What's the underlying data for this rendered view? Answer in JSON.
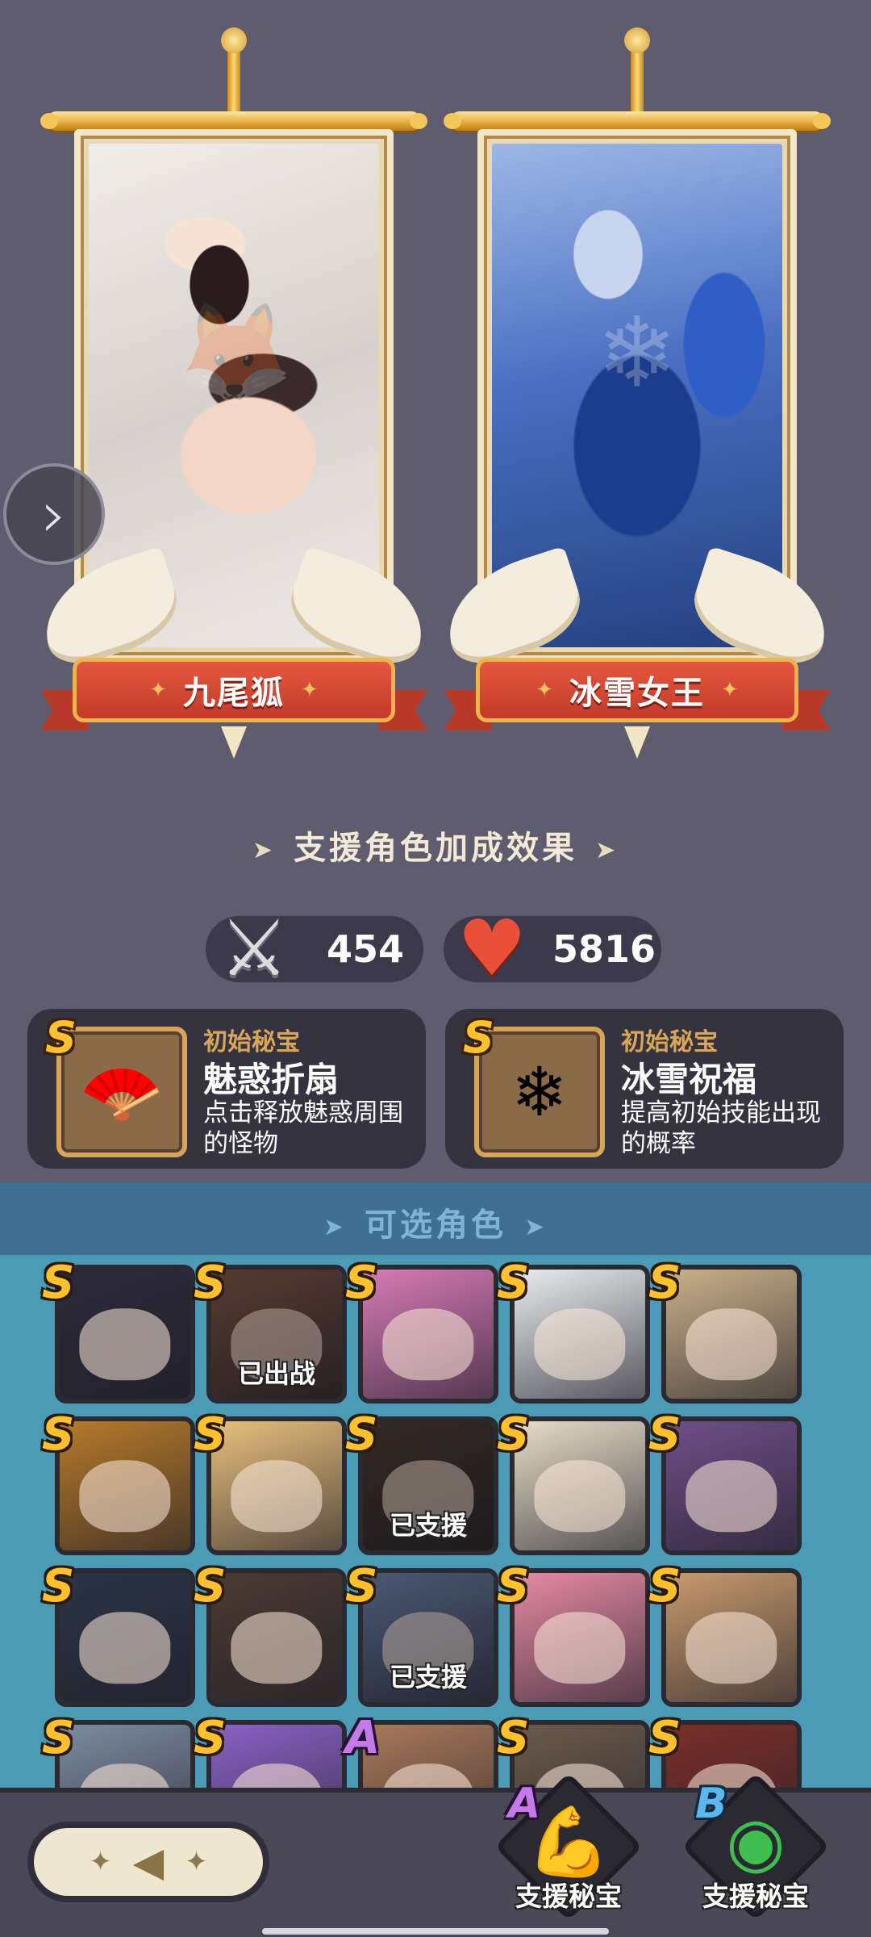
{
  "featured": [
    {
      "name": "九尾狐",
      "icon": "fox-spirit-portrait"
    },
    {
      "name": "冰雪女王",
      "icon": "ice-queen-portrait"
    }
  ],
  "bonus": {
    "title": "支援角色加成效果",
    "attack": {
      "icon": "sword-icon",
      "value": "454"
    },
    "health": {
      "icon": "heart-icon",
      "value": "5816"
    }
  },
  "treasures": [
    {
      "rank": "S",
      "kind": "初始秘宝",
      "name": "魅惑折扇",
      "desc": "点击释放魅惑周围的怪物",
      "icon": "fan-icon"
    },
    {
      "rank": "S",
      "kind": "初始秘宝",
      "name": "冰雪祝福",
      "desc": "提高初始技能出现的概率",
      "icon": "snowflake-compass-icon"
    }
  ],
  "roster": {
    "title": "可选角色",
    "heroes": [
      {
        "rank": "S",
        "status": "",
        "color": "#2d2a3a"
      },
      {
        "rank": "S",
        "status": "已出战",
        "color": "#7a5548"
      },
      {
        "rank": "S",
        "status": "",
        "color": "#d77bb6"
      },
      {
        "rank": "S",
        "status": "",
        "color": "#e9ecef"
      },
      {
        "rank": "S",
        "status": "",
        "color": "#c9b089"
      },
      {
        "rank": "S",
        "status": "",
        "color": "#b67a2a"
      },
      {
        "rank": "S",
        "status": "",
        "color": "#e8c07d"
      },
      {
        "rank": "S",
        "status": "已支援",
        "color": "#4a3b33"
      },
      {
        "rank": "S",
        "status": "",
        "color": "#e6dcc8"
      },
      {
        "rank": "S",
        "status": "",
        "color": "#6e4f88"
      },
      {
        "rank": "S",
        "status": "",
        "color": "#2b3446"
      },
      {
        "rank": "S",
        "status": "",
        "color": "#4a3a32"
      },
      {
        "rank": "S",
        "status": "已支援",
        "color": "#6b7ea5"
      },
      {
        "rank": "S",
        "status": "",
        "color": "#e58aa4"
      },
      {
        "rank": "S",
        "status": "",
        "color": "#c79a6d"
      },
      {
        "rank": "S",
        "status": "",
        "color": "#7d8ba0"
      },
      {
        "rank": "S",
        "status": "",
        "color": "#8a62c4"
      },
      {
        "rank": "A",
        "status": "",
        "color": "#a8795a"
      },
      {
        "rank": "S",
        "status": "",
        "color": "#6b5a4c"
      },
      {
        "rank": "S",
        "status": "",
        "color": "#7a2f2a"
      }
    ]
  },
  "bottom": {
    "back_icon": "back-arrow-icon",
    "supports": [
      {
        "rank": "A",
        "label": "支援秘宝",
        "icon": "muscle-figure-icon"
      },
      {
        "rank": "B",
        "label": "支援秘宝",
        "icon": "green-eye-icon"
      }
    ]
  }
}
